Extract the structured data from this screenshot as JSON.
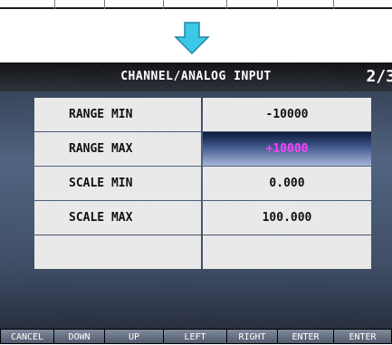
{
  "transition_arrow_icon": "down-arrow-icon",
  "header": {
    "title": "CHANNEL/ANALOG INPUT",
    "page": "2/3"
  },
  "rows": [
    {
      "label": "RANGE MIN",
      "value": "-10000"
    },
    {
      "label": "RANGE MAX",
      "value": "+10000"
    },
    {
      "label": "SCALE MIN",
      "value": "0.000"
    },
    {
      "label": "SCALE MAX",
      "value": "100.000"
    },
    {
      "label": "",
      "value": ""
    }
  ],
  "buttons": {
    "cancel": "CANCEL",
    "down": "DOWN",
    "up": "UP",
    "left": "LEFT",
    "right": "RIGHT",
    "enter": "ENTER"
  },
  "colors": {
    "arrow": "#3ec8e8",
    "selected_value": "#ff40ff"
  }
}
